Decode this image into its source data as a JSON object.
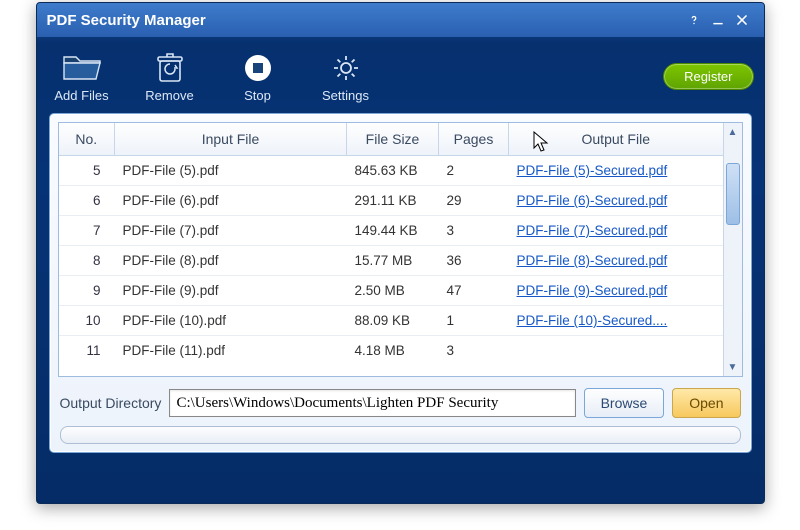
{
  "window": {
    "title": "PDF Security Manager"
  },
  "toolbar": {
    "addFiles": "Add Files",
    "remove": "Remove",
    "stop": "Stop",
    "settings": "Settings",
    "register": "Register"
  },
  "columns": {
    "no": "No.",
    "inputFile": "Input File",
    "fileSize": "File Size",
    "pages": "Pages",
    "outputFile": "Output File"
  },
  "rows": [
    {
      "no": "5",
      "file": "PDF-File (5).pdf",
      "size": "845.63 KB",
      "pages": "2",
      "out": "PDF-File (5)-Secured.pdf"
    },
    {
      "no": "6",
      "file": "PDF-File (6).pdf",
      "size": "291.11 KB",
      "pages": "29",
      "out": "PDF-File (6)-Secured.pdf"
    },
    {
      "no": "7",
      "file": "PDF-File (7).pdf",
      "size": "149.44 KB",
      "pages": "3",
      "out": "PDF-File (7)-Secured.pdf"
    },
    {
      "no": "8",
      "file": "PDF-File (8).pdf",
      "size": "15.77 MB",
      "pages": "36",
      "out": "PDF-File (8)-Secured.pdf"
    },
    {
      "no": "9",
      "file": "PDF-File (9).pdf",
      "size": "2.50 MB",
      "pages": "47",
      "out": "PDF-File (9)-Secured.pdf"
    },
    {
      "no": "10",
      "file": "PDF-File (10).pdf",
      "size": "88.09 KB",
      "pages": "1",
      "out": "PDF-File (10)-Secured...."
    },
    {
      "no": "11",
      "file": "PDF-File (11).pdf",
      "size": "4.18 MB",
      "pages": "3",
      "out": ""
    }
  ],
  "output": {
    "label": "Output Directory",
    "path": "C:\\Users\\Windows\\Documents\\Lighten PDF Security",
    "browse": "Browse",
    "open": "Open"
  }
}
